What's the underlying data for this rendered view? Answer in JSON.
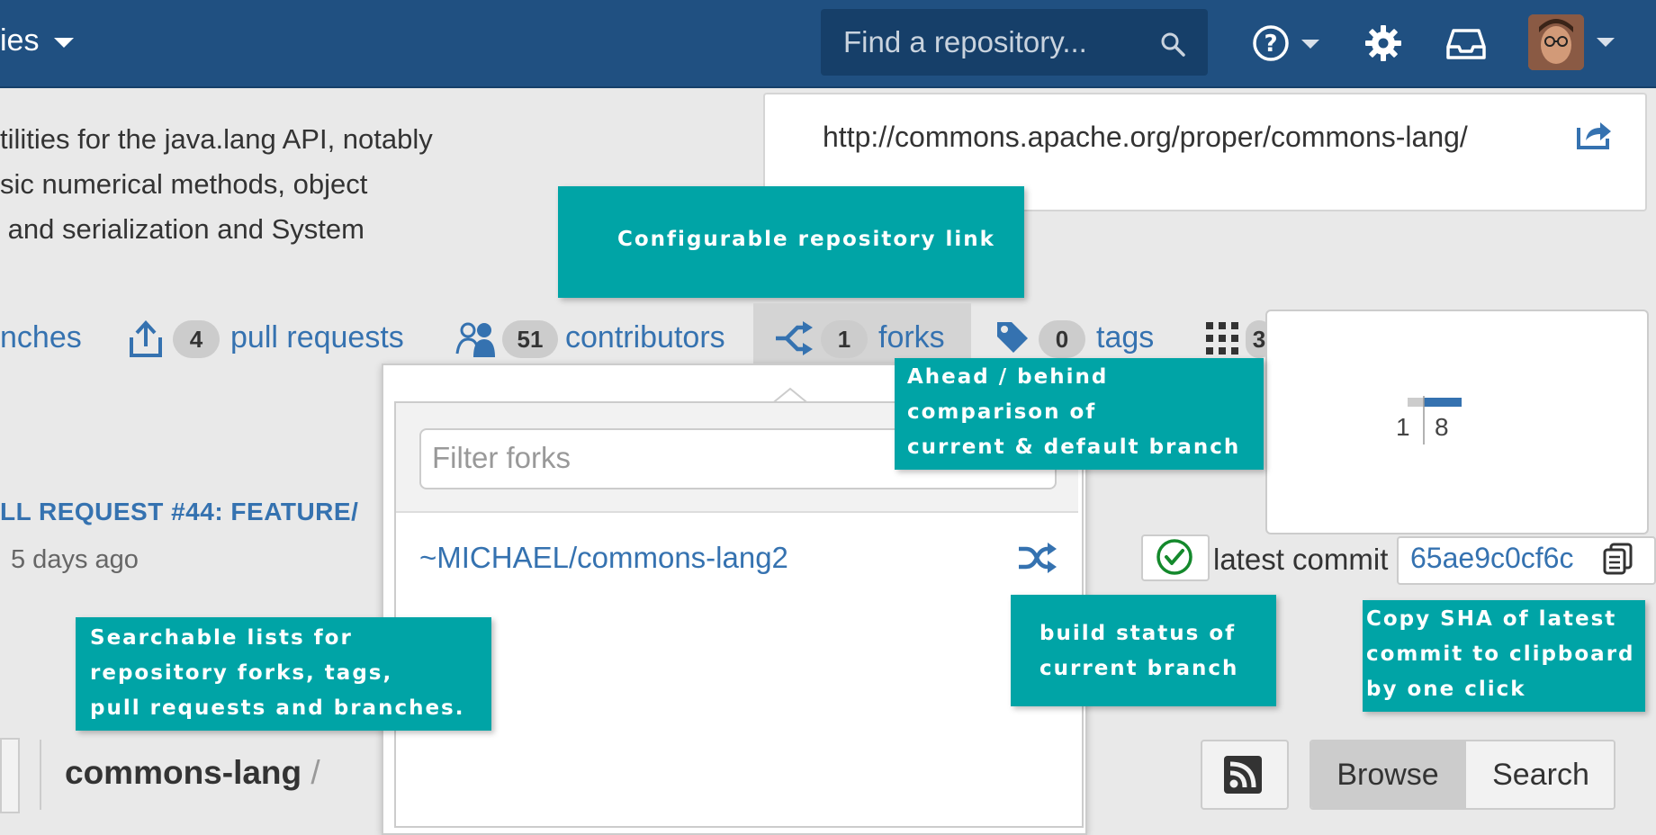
{
  "header": {
    "nav_label": "ies",
    "search_placeholder": "Find a repository...",
    "colors": {
      "bar": "#205081",
      "accent": "#3572b0",
      "callout": "#00a4a6"
    }
  },
  "description": {
    "lines": [
      "tilities for the java.lang API, notably",
      "sic numerical methods, object",
      " and serialization and System"
    ]
  },
  "repo_link": {
    "url": "http://commons.apache.org/proper/commons-lang/"
  },
  "stats": {
    "branches_label": "nches",
    "pull_requests": {
      "count": "4",
      "label": "pull requests"
    },
    "contributors": {
      "count": "51",
      "label": "contributors"
    },
    "forks": {
      "count": "1",
      "label": "forks"
    },
    "tags": {
      "count": "0",
      "label": "tags"
    },
    "more_count": "3"
  },
  "forks_dropdown": {
    "filter_placeholder": "Filter forks",
    "items": [
      {
        "name": "~MICHAEL/commons-lang2"
      }
    ]
  },
  "ahead_behind": {
    "behind": "1",
    "ahead": "8"
  },
  "pull_request": {
    "title": "LL REQUEST #44: FEATURE/",
    "time": "5 days ago"
  },
  "latest_commit": {
    "label": "latest commit",
    "sha": "65ae9c0cf6c"
  },
  "bottom": {
    "repo_name": "commons-lang",
    "slash": "/",
    "browse_label": "Browse",
    "search_label": "Search"
  },
  "callouts": {
    "repo_link": [
      "Configurable repository link"
    ],
    "ahead_behind": [
      "Ahead / behind",
      "comparison of",
      "current & default branch"
    ],
    "searchable": [
      "Searchable lists for",
      "repository forks, tags,",
      "pull requests and branches."
    ],
    "build_status": [
      "build status of",
      "current branch"
    ],
    "copy_sha": [
      "Copy SHA of latest",
      "commit to clipboard",
      "by one click"
    ]
  }
}
